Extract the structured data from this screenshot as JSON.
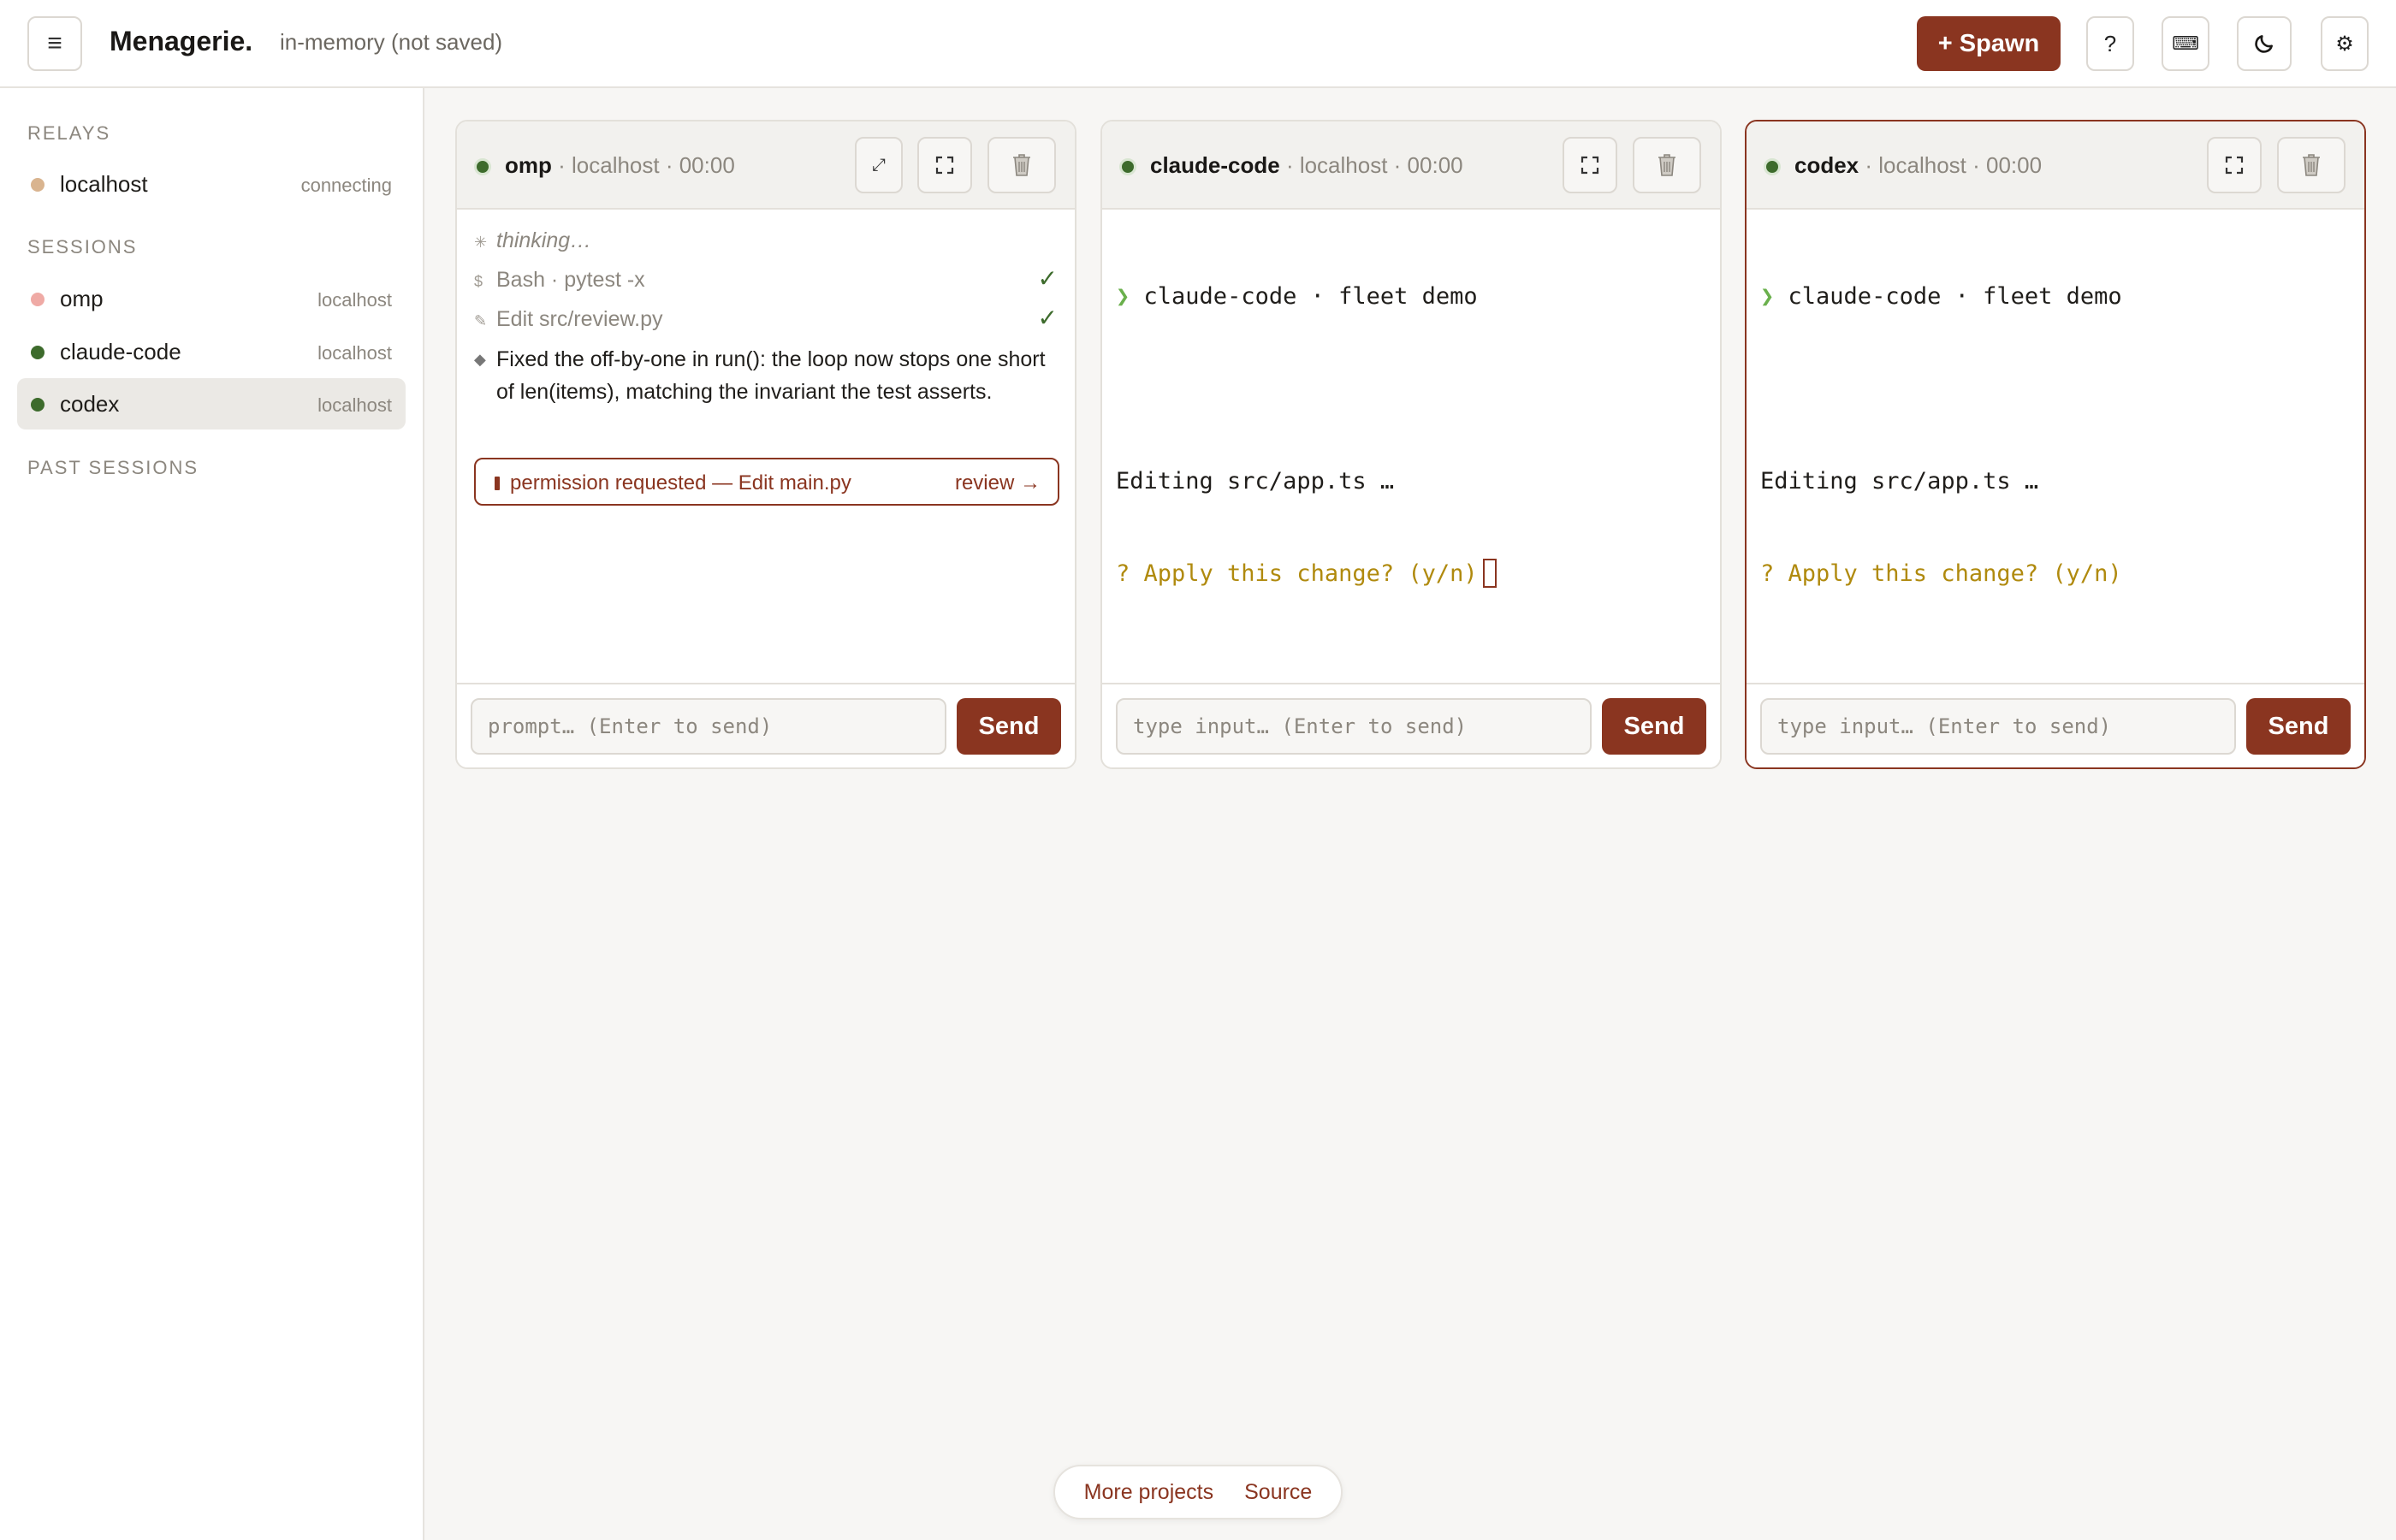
{
  "app": {
    "menu_icon": "hamburger-icon",
    "brand": "Menagerie.",
    "storage_status": "in-memory (not saved)"
  },
  "toolbar": {
    "spawn_label": "+ Spawn",
    "help_label": "?",
    "keyboard_icon": "⌨",
    "theme_icon": "moon-icon",
    "settings_icon": "⚙"
  },
  "sidebar": {
    "relays_label": "RELAYS",
    "relays": [
      {
        "name": "localhost",
        "status": "connecting",
        "dot_color": "#d9b48f"
      }
    ],
    "sessions_label": "SESSIONS",
    "sessions": [
      {
        "name": "omp",
        "host": "localhost",
        "dot_color": "#efaaa5"
      },
      {
        "name": "claude-code",
        "host": "localhost",
        "dot_color": "#3d6b2c"
      },
      {
        "name": "codex",
        "host": "localhost",
        "dot_color": "#3d6b2c",
        "active": true
      }
    ],
    "past_sessions_label": "PAST SESSIONS"
  },
  "panels": [
    {
      "name": "omp",
      "meta": " · localhost · 00:00",
      "events": [
        {
          "glyph": "✳",
          "text": "thinking…"
        },
        {
          "glyph": "$",
          "text": "Bash · pytest -x",
          "check": "✓"
        },
        {
          "glyph": "✎",
          "text": "Edit src/review.py",
          "check": "✓"
        }
      ],
      "message_glyph": "◆",
      "message": "Fixed the off-by-one in run(): the loop now stops one short of len(items), matching the invariant the test asserts.",
      "permission": {
        "text": "permission requested — Edit main.py",
        "action": "review →"
      },
      "input_placeholder": "prompt… (Enter to send)",
      "send_label": "Send"
    },
    {
      "name": "claude-code",
      "meta": " · localhost · 00:00",
      "prompt_glyph": "❯",
      "lines": [
        "claude-code · fleet demo",
        "Editing src/app.ts …",
        "? Apply this change? (y/n)"
      ],
      "input_placeholder": "type input… (Enter to send)",
      "send_label": "Send"
    },
    {
      "name": "codex",
      "meta": " · localhost · 00:00",
      "prompt_glyph": "❯",
      "lines": [
        "claude-code · fleet demo",
        "Editing src/app.ts …",
        "? Apply this change? (y/n)"
      ],
      "input_placeholder": "type input… (Enter to send)",
      "send_label": "Send"
    }
  ],
  "footer": {
    "more_projects": "More projects",
    "source": "Source"
  },
  "colors": {
    "accent": "#8a3520",
    "live": "#3d6b2c",
    "prompt": "#6ab04c",
    "question": "#b08a0e"
  }
}
